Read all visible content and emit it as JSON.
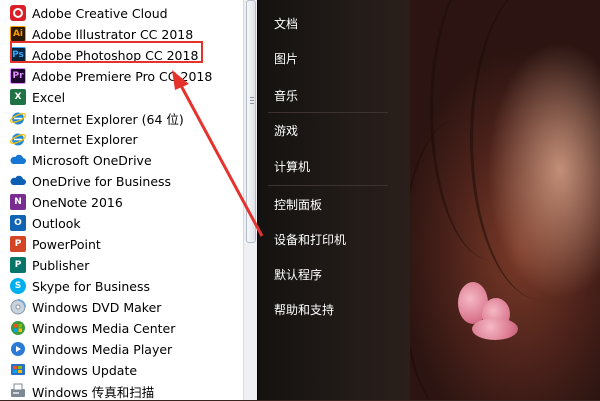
{
  "programs": [
    {
      "label": "Adobe Creative Cloud",
      "icon": "creative-cloud-icon"
    },
    {
      "label": "Adobe Illustrator CC 2018",
      "icon": "illustrator-icon"
    },
    {
      "label": "Adobe Photoshop CC 2018",
      "icon": "photoshop-icon"
    },
    {
      "label": "Adobe Premiere Pro CC 2018",
      "icon": "premiere-icon"
    },
    {
      "label": "Excel",
      "icon": "excel-icon"
    },
    {
      "label": "Internet Explorer (64 位)",
      "icon": "internet-explorer-icon"
    },
    {
      "label": "Internet Explorer",
      "icon": "internet-explorer-icon"
    },
    {
      "label": "Microsoft OneDrive",
      "icon": "onedrive-icon"
    },
    {
      "label": "OneDrive for Business",
      "icon": "onedrive-business-icon"
    },
    {
      "label": "OneNote 2016",
      "icon": "onenote-icon"
    },
    {
      "label": "Outlook",
      "icon": "outlook-icon"
    },
    {
      "label": "PowerPoint",
      "icon": "powerpoint-icon"
    },
    {
      "label": "Publisher",
      "icon": "publisher-icon"
    },
    {
      "label": "Skype for Business",
      "icon": "skype-icon"
    },
    {
      "label": "Windows DVD Maker",
      "icon": "dvd-maker-icon"
    },
    {
      "label": "Windows Media Center",
      "icon": "media-center-icon"
    },
    {
      "label": "Windows Media Player",
      "icon": "media-player-icon"
    },
    {
      "label": "Windows Update",
      "icon": "windows-update-icon"
    },
    {
      "label": "Windows 传真和扫描",
      "icon": "fax-scan-icon"
    }
  ],
  "icon_glyphs": {
    "illustrator": "Ai",
    "photoshop": "Ps",
    "premiere": "Pr",
    "excel": "X",
    "onenote": "N",
    "outlook": "O",
    "powerpoint": "P",
    "publisher": "P",
    "skype": "S"
  },
  "right_menu": {
    "documents": "文档",
    "pictures": "图片",
    "music": "音乐",
    "games": "游戏",
    "computer": "计算机",
    "control_panel": "控制面板",
    "devices_printers": "设备和打印机",
    "default_programs": "默认程序",
    "help_support": "帮助和支持"
  },
  "colors": {
    "highlight": "#e5322d",
    "creative_cloud": "#da1f26",
    "illustrator_bg": "#2b1a02",
    "illustrator_fg": "#ff9a00",
    "photoshop_bg": "#05233b",
    "photoshop_fg": "#31a8ff",
    "premiere_bg": "#1e0a2e",
    "premiere_fg": "#e28fff",
    "excel": "#1f7244",
    "onenote": "#7b2c91",
    "outlook": "#0f64b4",
    "powerpoint": "#d24625",
    "publisher": "#077568",
    "skype": "#00aff0"
  }
}
